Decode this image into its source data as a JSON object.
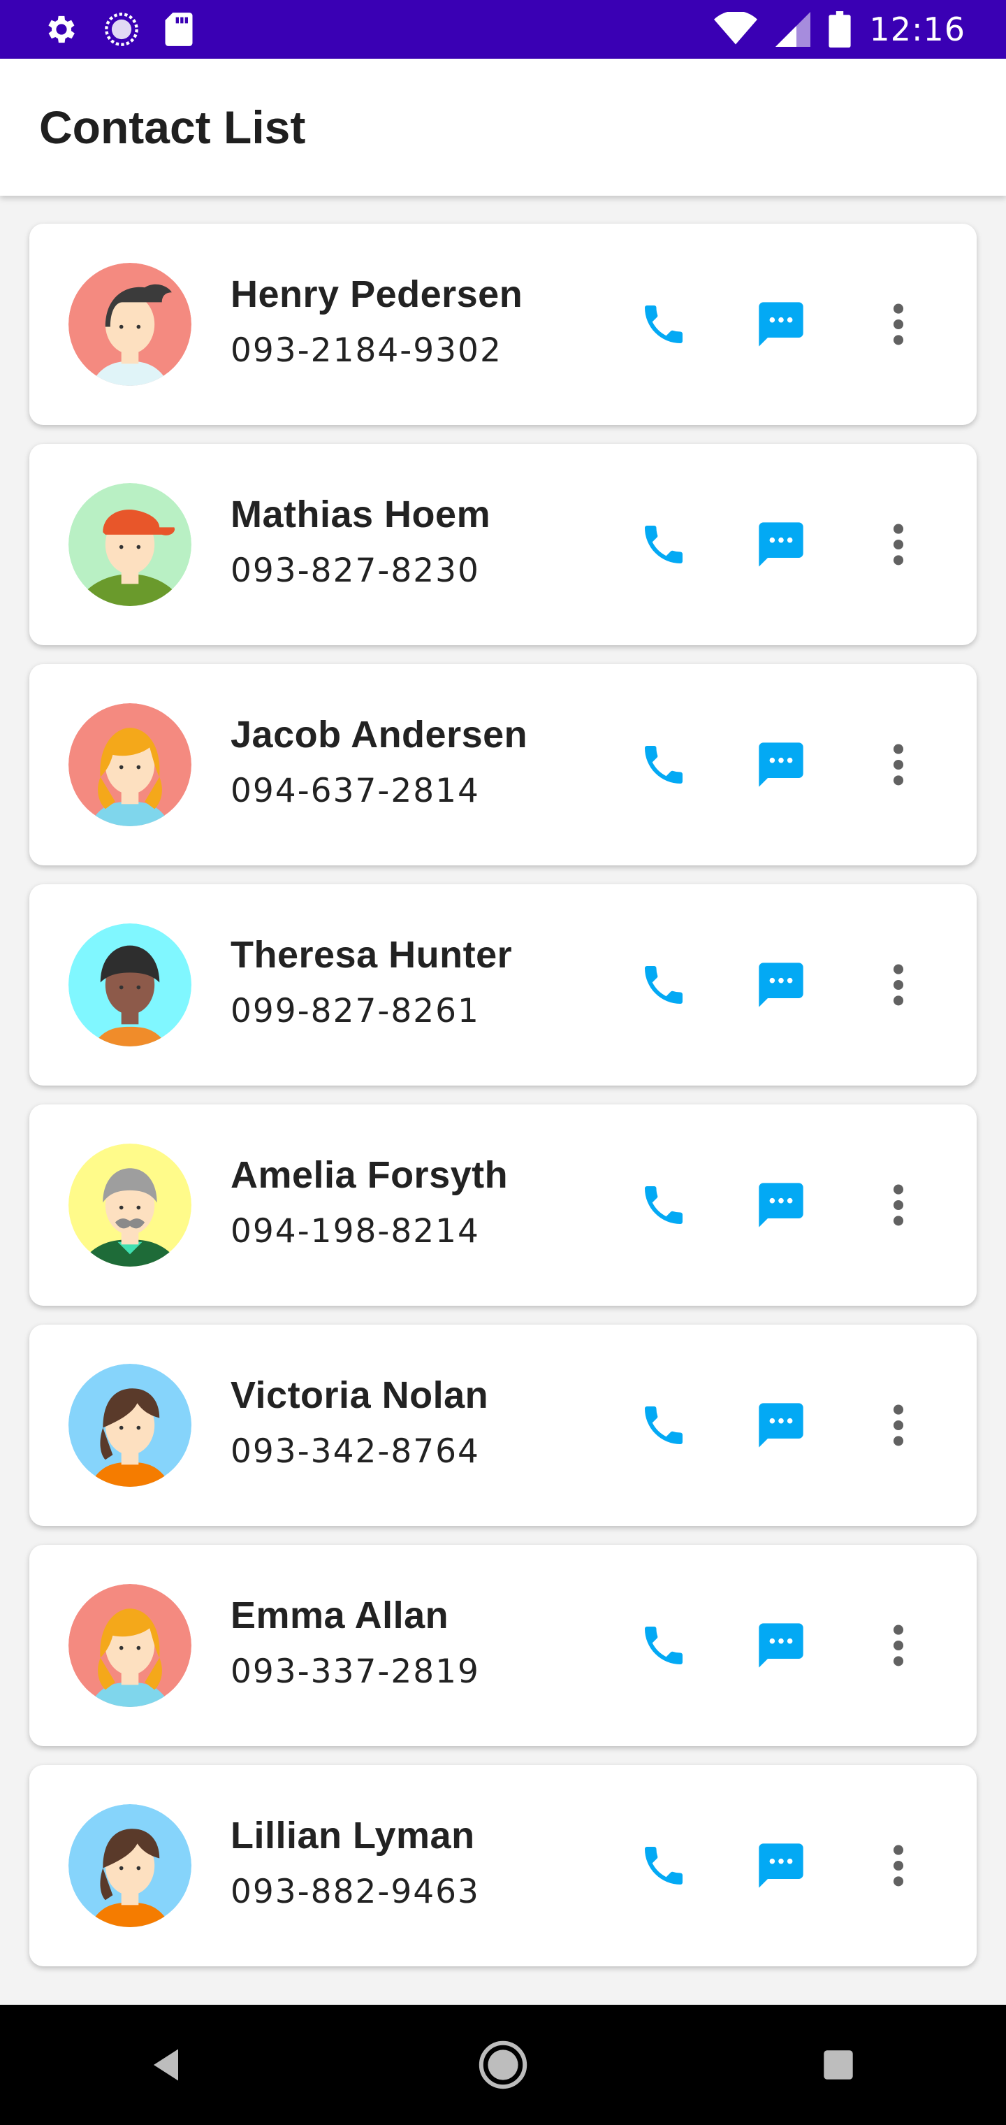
{
  "status_bar": {
    "time": "12:16"
  },
  "app_bar": {
    "title": "Contact List"
  },
  "colors": {
    "status_bar": "#3a00b4",
    "action_blue": "#03a9f4",
    "more_gray": "#616161"
  },
  "contacts": [
    {
      "name": "Henry Pedersen",
      "phone": "093-2184-9302",
      "avatar": "avatar-dark-hair-man",
      "avatar_bg": "#f48a80"
    },
    {
      "name": "Mathias Hoem",
      "phone": "093-827-8230",
      "avatar": "avatar-cap-man",
      "avatar_bg": "#b9f0c4"
    },
    {
      "name": "Jacob Andersen",
      "phone": "094-637-2814",
      "avatar": "avatar-blonde-woman",
      "avatar_bg": "#f48a80"
    },
    {
      "name": "Theresa Hunter",
      "phone": "099-827-8261",
      "avatar": "avatar-dark-skin-person",
      "avatar_bg": "#80f7ff"
    },
    {
      "name": "Amelia Forsyth",
      "phone": "094-198-8214",
      "avatar": "avatar-old-man-mustache",
      "avatar_bg": "#fffb8a"
    },
    {
      "name": "Victoria Nolan",
      "phone": "093-342-8764",
      "avatar": "avatar-brown-hair-woman",
      "avatar_bg": "#86d4fb"
    },
    {
      "name": "Emma Allan",
      "phone": "093-337-2819",
      "avatar": "avatar-blonde-woman",
      "avatar_bg": "#f48a80"
    },
    {
      "name": "Lillian Lyman",
      "phone": "093-882-9463",
      "avatar": "avatar-brown-hair-woman",
      "avatar_bg": "#86d4fb"
    }
  ]
}
